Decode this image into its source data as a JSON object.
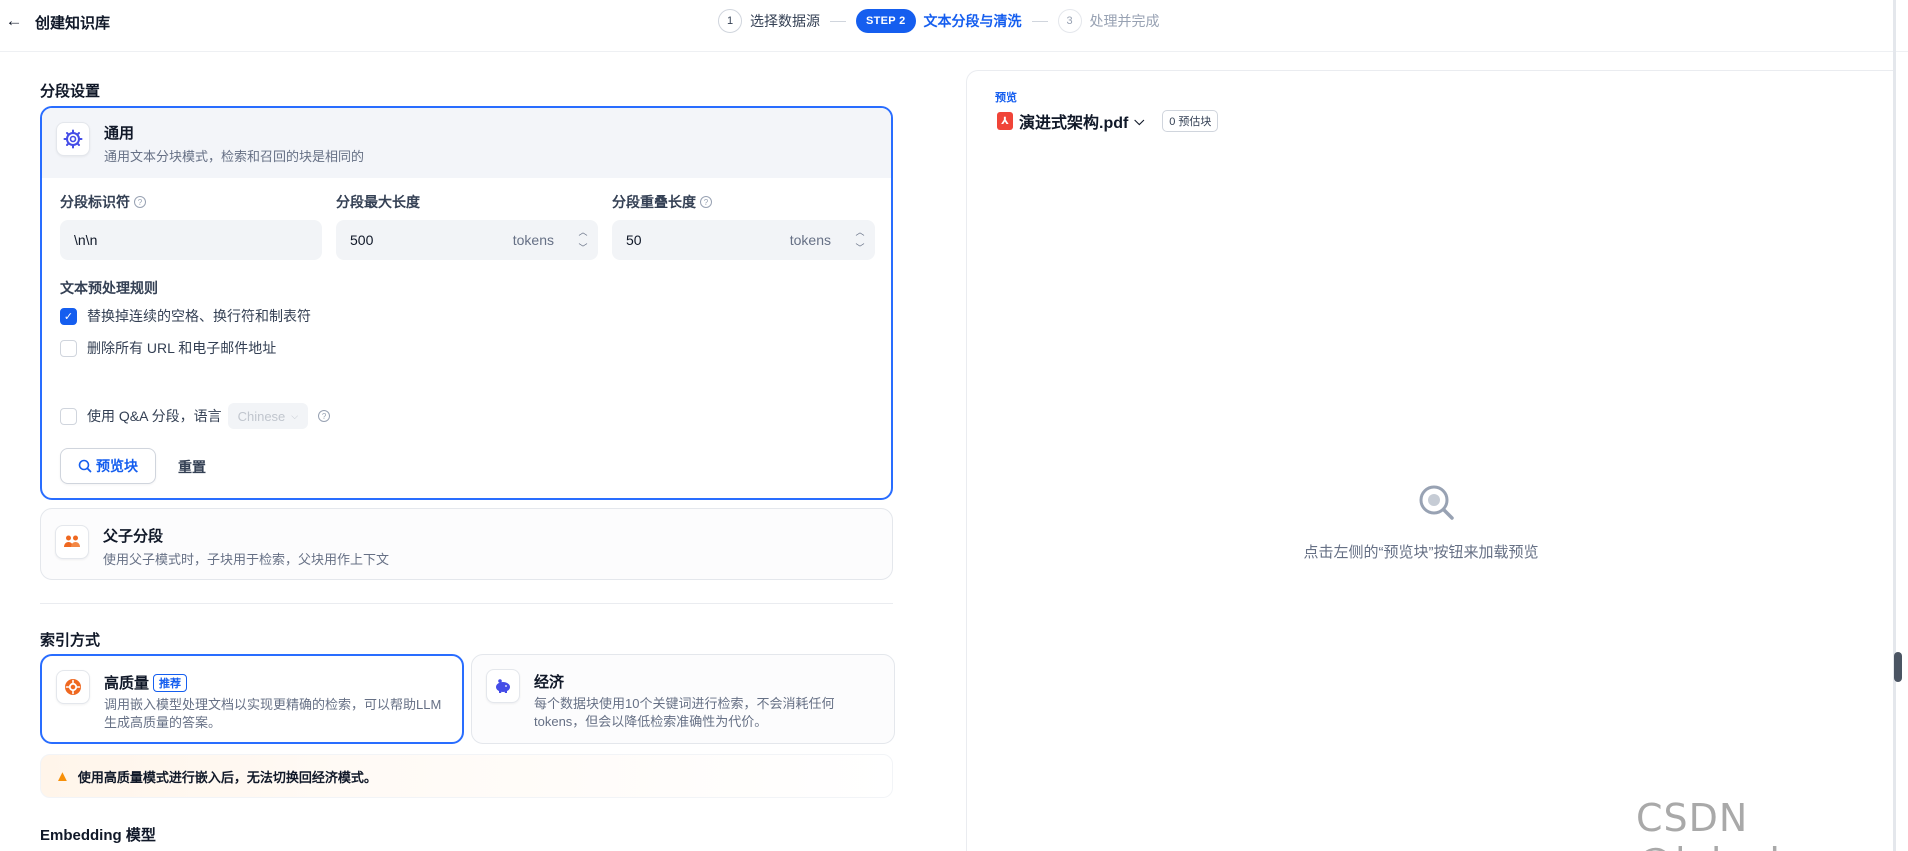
{
  "header": {
    "back_icon": "arrow-left-icon",
    "title": "创建知识库",
    "steps": [
      {
        "badge": "1",
        "label": "选择数据源"
      },
      {
        "badge": "STEP 2",
        "label": "文本分段与清洗"
      },
      {
        "badge": "3",
        "label": "处理并完成"
      }
    ]
  },
  "segment": {
    "section_title": "分段设置",
    "general": {
      "icon": "gear-icon",
      "title": "通用",
      "desc": "通用文本分块模式，检索和召回的块是相同的",
      "identifier": {
        "label": "分段标识符",
        "value": "\\n\\n"
      },
      "max_length": {
        "label": "分段最大长度",
        "value": "500",
        "unit": "tokens"
      },
      "overlap": {
        "label": "分段重叠长度",
        "value": "50",
        "unit": "tokens"
      },
      "rules_title": "文本预处理规则",
      "rules": [
        {
          "label": "替换掉连续的空格、换行符和制表符",
          "checked": true
        },
        {
          "label": "删除所有 URL 和电子邮件地址",
          "checked": false
        }
      ],
      "qa": {
        "label": "使用 Q&A 分段，语言",
        "checked": false,
        "language": "Chinese"
      },
      "preview_button": "预览块",
      "reset_button": "重置"
    },
    "parent_child": {
      "icon": "people-icon",
      "title": "父子分段",
      "desc": "使用父子模式时，子块用于检索，父块用作上下文"
    }
  },
  "index": {
    "section_title": "索引方式",
    "high_quality": {
      "icon": "star-icon",
      "title": "高质量",
      "badge": "推荐",
      "desc": "调用嵌入模型处理文档以实现更精确的检索，可以帮助LLM生成高质量的答案。"
    },
    "economy": {
      "icon": "piggy-bank-icon",
      "title": "经济",
      "desc": "每个数据块使用10个关键词进行检索，不会消耗任何 tokens，但会以降低检索准确性为代价。"
    },
    "warning": "使用高质量模式进行嵌入后，无法切换回经济模式。"
  },
  "embedding": {
    "section_title": "Embedding 模型"
  },
  "preview": {
    "label": "预览",
    "file_name": "演进式架构.pdf",
    "chunk_count": "0 预估块",
    "empty_text": "点击左侧的“预览块”按钮来加载预览"
  },
  "watermark": "CSDN @leluckys",
  "colors": {
    "accent": "#155eef",
    "border_selected": "#296dff",
    "warning": "#f79009",
    "pdf": "#f04438"
  }
}
